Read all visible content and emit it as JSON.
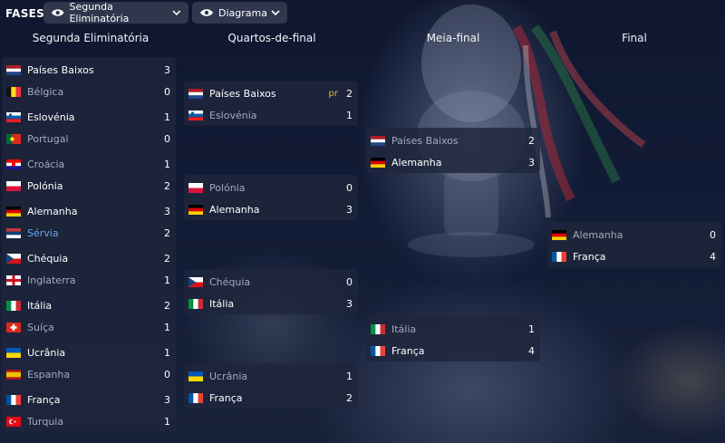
{
  "header": {
    "title": "FASES",
    "stage_select": "Segunda Eliminatória",
    "view_select": "Diagrama"
  },
  "columns": {
    "r16": "Segunda Eliminatória",
    "qf": "Quartos-de-final",
    "sf": "Meia-final",
    "final": "Final"
  },
  "matches": {
    "r16": [
      {
        "home": {
          "team": "Países Baixos",
          "score": "3",
          "flag": "nl"
        },
        "away": {
          "team": "Bélgica",
          "score": "0",
          "flag": "be"
        }
      },
      {
        "home": {
          "team": "Eslovénia",
          "score": "1",
          "flag": "si"
        },
        "away": {
          "team": "Portugal",
          "score": "0",
          "flag": "pt"
        }
      },
      {
        "home": {
          "team": "Croácia",
          "score": "1",
          "flag": "hr"
        },
        "away": {
          "team": "Polónia",
          "score": "2",
          "flag": "pl"
        }
      },
      {
        "home": {
          "team": "Alemanha",
          "score": "3",
          "flag": "de"
        },
        "away": {
          "team": "Sérvia",
          "score": "2",
          "flag": "rs"
        }
      },
      {
        "home": {
          "team": "Chéquia",
          "score": "2",
          "flag": "cz"
        },
        "away": {
          "team": "Inglaterra",
          "score": "1",
          "flag": "en"
        }
      },
      {
        "home": {
          "team": "Itália",
          "score": "2",
          "flag": "it"
        },
        "away": {
          "team": "Suíça",
          "score": "1",
          "flag": "ch"
        }
      },
      {
        "home": {
          "team": "Ucrânia",
          "score": "1",
          "flag": "ua"
        },
        "away": {
          "team": "Espanha",
          "score": "0",
          "flag": "es"
        }
      },
      {
        "home": {
          "team": "França",
          "score": "3",
          "flag": "fr"
        },
        "away": {
          "team": "Turquia",
          "score": "1",
          "flag": "tr"
        }
      }
    ],
    "qf": [
      {
        "home": {
          "team": "Países Baixos",
          "score": "2",
          "note": "pr",
          "flag": "nl"
        },
        "away": {
          "team": "Eslovénia",
          "score": "1",
          "flag": "si"
        }
      },
      {
        "home": {
          "team": "Polónia",
          "score": "0",
          "flag": "pl"
        },
        "away": {
          "team": "Alemanha",
          "score": "3",
          "flag": "de"
        }
      },
      {
        "home": {
          "team": "Chéquia",
          "score": "0",
          "flag": "cz"
        },
        "away": {
          "team": "Itália",
          "score": "3",
          "flag": "it"
        }
      },
      {
        "home": {
          "team": "Ucrânia",
          "score": "1",
          "flag": "ua"
        },
        "away": {
          "team": "França",
          "score": "2",
          "flag": "fr"
        }
      }
    ],
    "sf": [
      {
        "home": {
          "team": "Países Baixos",
          "score": "2",
          "flag": "nl"
        },
        "away": {
          "team": "Alemanha",
          "score": "3",
          "flag": "de"
        }
      },
      {
        "home": {
          "team": "Itália",
          "score": "1",
          "flag": "it"
        },
        "away": {
          "team": "França",
          "score": "4",
          "flag": "fr"
        }
      }
    ],
    "final": [
      {
        "home": {
          "team": "Alemanha",
          "score": "0",
          "flag": "de"
        },
        "away": {
          "team": "França",
          "score": "4",
          "flag": "fr"
        }
      }
    ]
  }
}
